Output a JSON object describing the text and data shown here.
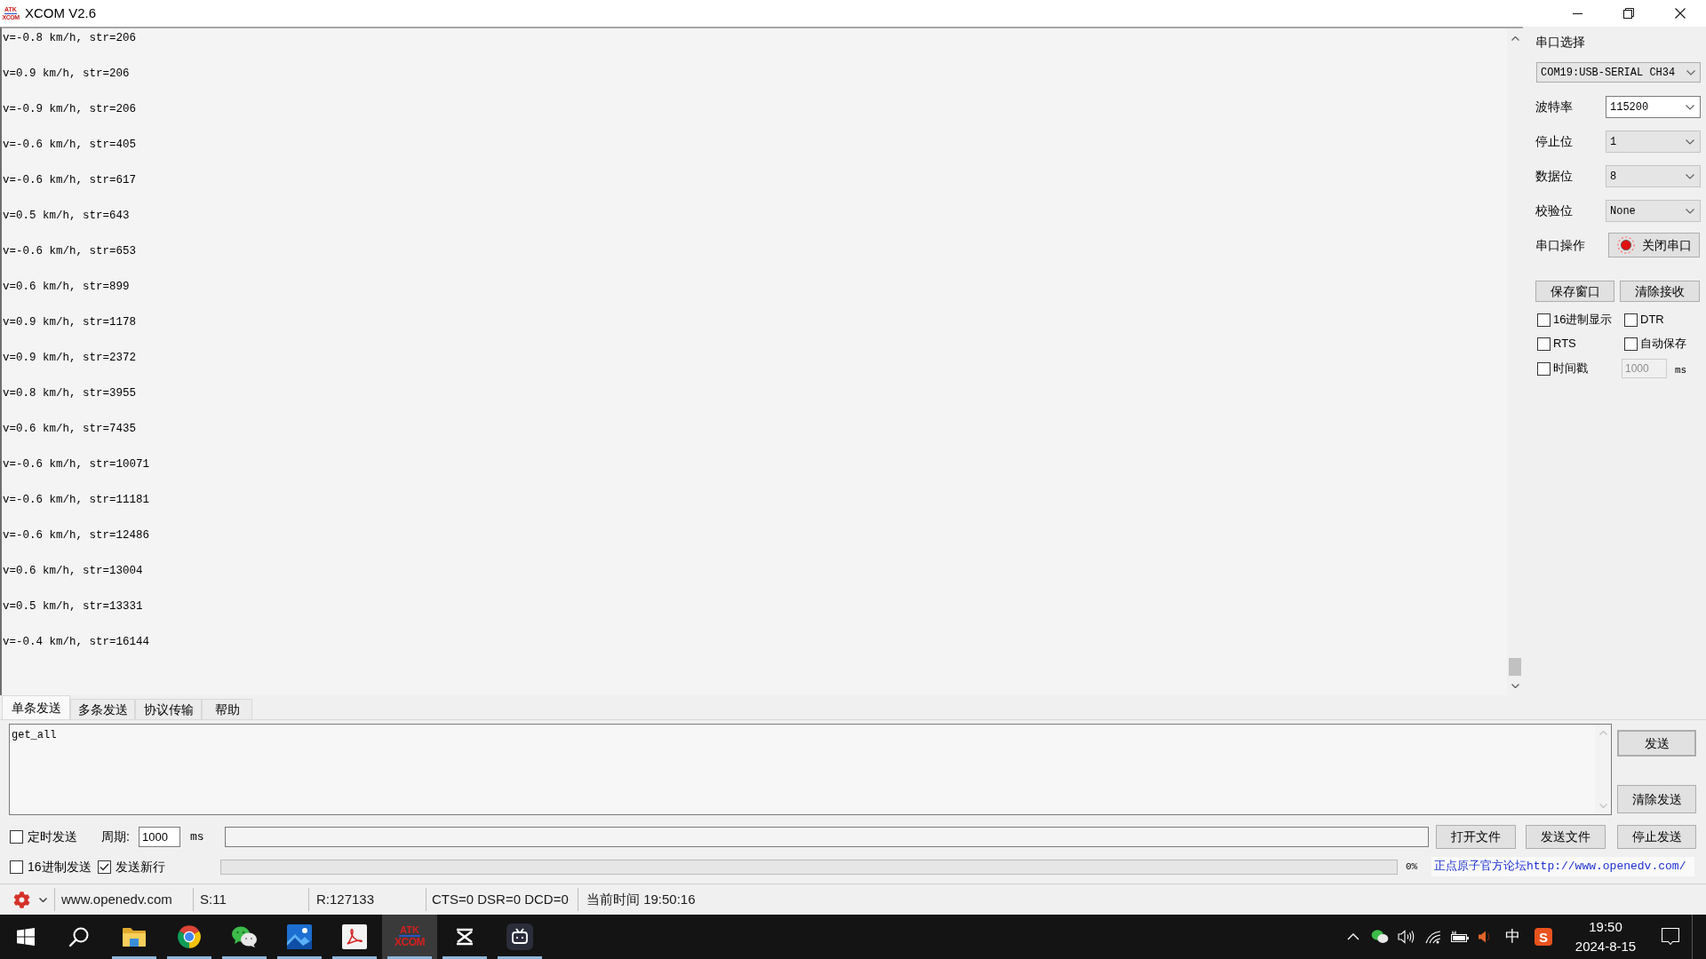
{
  "window": {
    "title": "XCOM V2.6",
    "logo_text": [
      "ATK",
      "XCOM"
    ]
  },
  "receive_area": {
    "lines": [
      "v=-0.8 km/h, str=206",
      "v=0.9 km/h, str=206",
      "v=-0.9 km/h, str=206",
      "v=-0.6 km/h, str=405",
      "v=-0.6 km/h, str=617",
      "v=0.5 km/h, str=643",
      "v=-0.6 km/h, str=653",
      "v=0.6 km/h, str=899",
      "v=0.9 km/h, str=1178",
      "v=0.9 km/h, str=2372",
      "v=0.8 km/h, str=3955",
      "v=0.6 km/h, str=7435",
      "v=-0.6 km/h, str=10071",
      "v=-0.6 km/h, str=11181",
      "v=-0.6 km/h, str=12486",
      "v=0.6 km/h, str=13004",
      "v=0.5 km/h, str=13331",
      "v=-0.4 km/h, str=16144"
    ]
  },
  "serial_panel": {
    "port_label": "串口选择",
    "port_value": "COM19:USB-SERIAL CH34",
    "settings": [
      {
        "label": "波特率",
        "value": "115200",
        "editable": true
      },
      {
        "label": "停止位",
        "value": "1",
        "editable": false
      },
      {
        "label": "数据位",
        "value": "8",
        "editable": false
      },
      {
        "label": "校验位",
        "value": "None",
        "editable": false
      }
    ],
    "operation": {
      "label": "串口操作",
      "button": "关闭串口",
      "port_open": true
    },
    "buttons": [
      "保存窗口",
      "清除接收"
    ],
    "options": [
      {
        "label": "16进制显示",
        "checked": false
      },
      {
        "label": "DTR",
        "checked": false
      },
      {
        "label": "RTS",
        "checked": false
      },
      {
        "label": "自动保存",
        "checked": false
      }
    ],
    "timestamp": {
      "label": "时间戳",
      "checked": false,
      "interval": "1000",
      "unit": "ms"
    }
  },
  "send_tabs": [
    {
      "label": "单条发送",
      "selected": true
    },
    {
      "label": "多条发送",
      "selected": false
    },
    {
      "label": "协议传输",
      "selected": false
    },
    {
      "label": "帮助",
      "selected": false
    }
  ],
  "send_panel": {
    "text": "get_all",
    "send_button": {
      "label": "发送",
      "focused": true
    },
    "clear_button": "清除发送",
    "timed_send": {
      "label": "定时发送",
      "checked": false
    },
    "period": {
      "label": "周期:",
      "value": "1000",
      "unit": "ms"
    },
    "file_buttons": [
      "打开文件",
      "发送文件",
      "停止发送"
    ],
    "hex_send": {
      "label": "16进制发送",
      "checked": false
    },
    "send_newline": {
      "label": "发送新行",
      "checked": true
    },
    "progress": {
      "level": 0,
      "reading": "0%"
    },
    "forum_link": "正点原子官方论坛http://www.openedv.com/"
  },
  "status_bar": {
    "website": "www.openedv.com",
    "sent": "S:11",
    "received": "R:127133",
    "signals": "CTS=0 DSR=0 DCD=0",
    "time": "当前时间 19:50:16"
  },
  "taskbar": {
    "apps": [
      {
        "kind": "start",
        "running": false,
        "active": false
      },
      {
        "kind": "search",
        "running": false,
        "active": false
      },
      {
        "kind": "folder",
        "running": true,
        "active": false
      },
      {
        "kind": "browser",
        "running": true,
        "active": false
      },
      {
        "kind": "chat",
        "running": true,
        "active": false
      },
      {
        "kind": "photos",
        "running": true,
        "active": false
      },
      {
        "kind": "pdf",
        "running": true,
        "active": false
      },
      {
        "kind": "xcom",
        "running": true,
        "active": true,
        "logo_text": [
          "ATK",
          "XCOM"
        ]
      },
      {
        "kind": "editor",
        "running": true,
        "active": false
      },
      {
        "kind": "bot",
        "running": true,
        "active": false
      }
    ],
    "tray": {
      "ime_mode": "中",
      "ime_logo": "S"
    },
    "clock": {
      "time": "19:50",
      "date": "2024-8-15"
    }
  }
}
